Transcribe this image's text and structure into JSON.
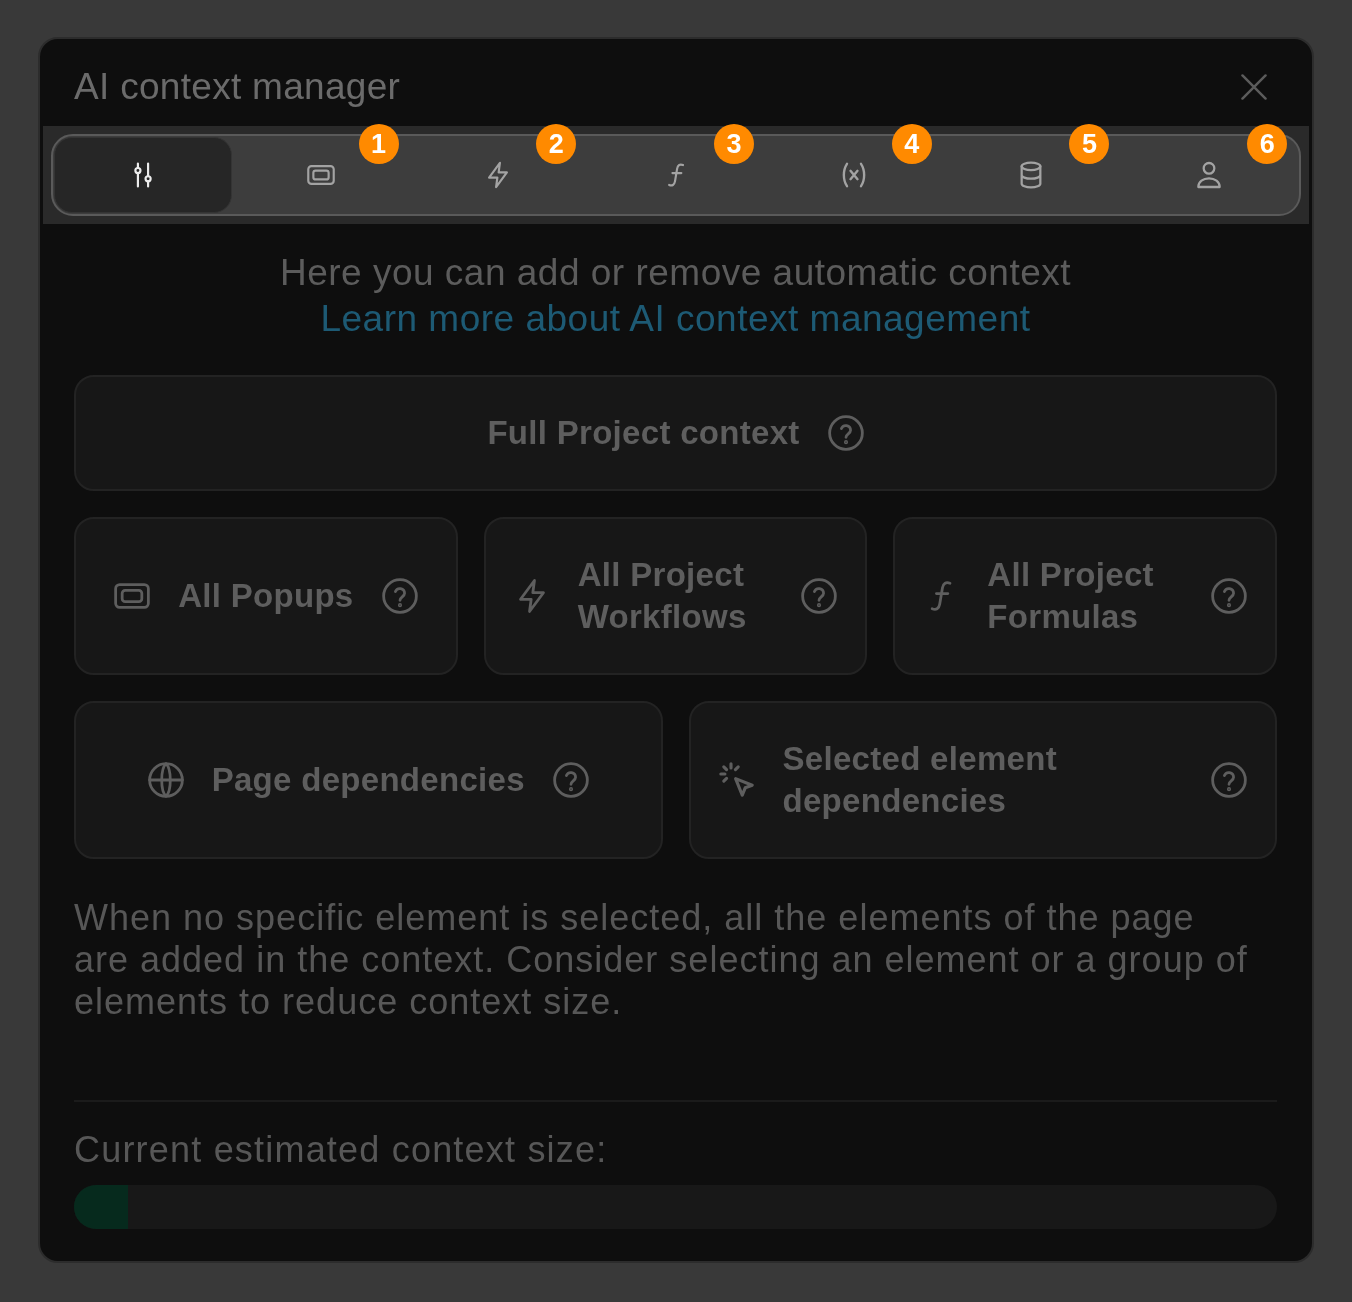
{
  "dialog": {
    "title": "AI context manager"
  },
  "tabs": [
    {
      "kind": "sliders",
      "selected": true
    },
    {
      "kind": "popup",
      "selected": false,
      "badge": "1"
    },
    {
      "kind": "lightning",
      "selected": false,
      "badge": "2"
    },
    {
      "kind": "function",
      "selected": false,
      "badge": "3"
    },
    {
      "kind": "variable",
      "selected": false,
      "badge": "4"
    },
    {
      "kind": "database",
      "selected": false,
      "badge": "5"
    },
    {
      "kind": "user",
      "selected": false,
      "badge": "6"
    }
  ],
  "intro": {
    "text": "Here you can add or remove automatic context",
    "link": "Learn more about AI context management"
  },
  "option_rows": [
    [
      {
        "kind": "plain",
        "label": "Full Project context"
      }
    ],
    [
      {
        "kind": "popup",
        "label": "All Popups"
      },
      {
        "kind": "lightning",
        "label": "All Project Workflows"
      },
      {
        "kind": "function",
        "label": "All Project Formulas"
      }
    ],
    [
      {
        "kind": "globe",
        "label": "Page dependencies"
      },
      {
        "kind": "cursor",
        "label": "Selected element dependencies"
      }
    ]
  ],
  "note": "When no specific element is selected, all the elements of the page are added in the context. Consider selecting an element or a group of elements to reduce context size.",
  "context_size": {
    "label": "Current estimated context size:",
    "level": 0.045
  }
}
